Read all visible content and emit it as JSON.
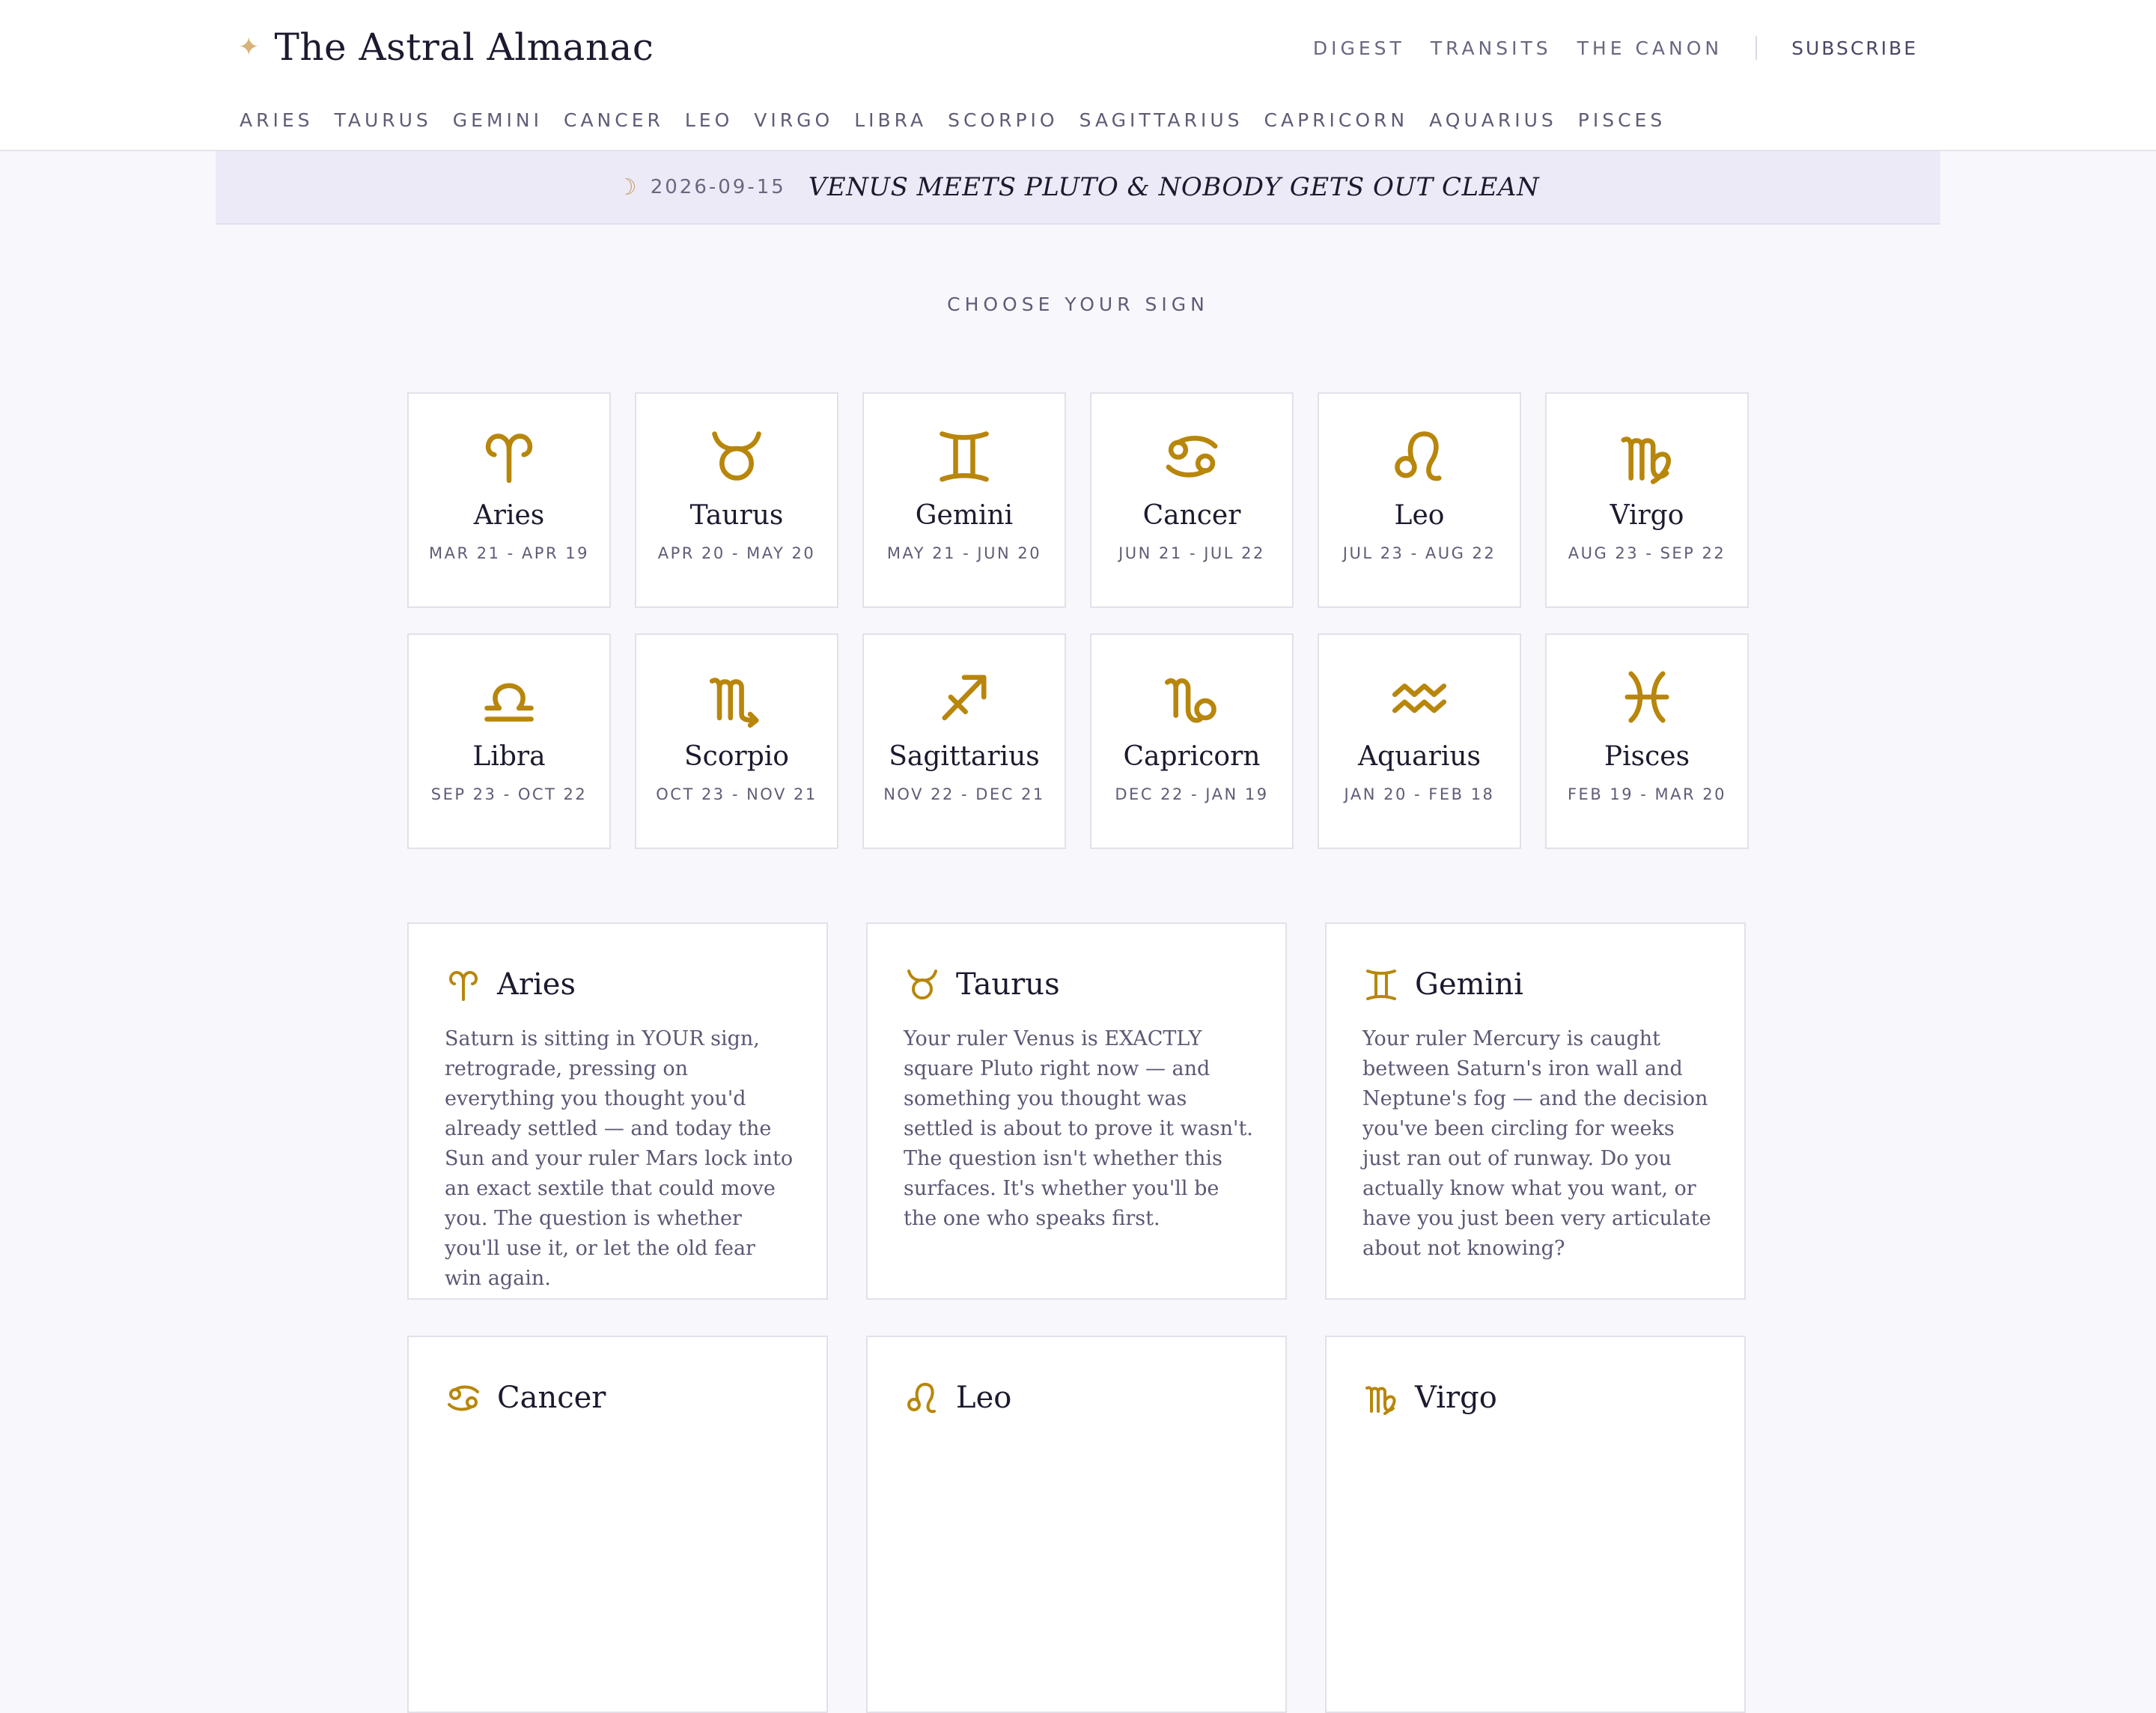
{
  "brand": {
    "title": "The Astral Almanac",
    "icon": "star-icon"
  },
  "topnav": {
    "digest": "DIGEST",
    "transits": "TRANSITS",
    "canon": "THE CANON",
    "subscribe": "SUBSCRIBE"
  },
  "signnav": [
    "ARIES",
    "TAURUS",
    "GEMINI",
    "CANCER",
    "LEO",
    "VIRGO",
    "LIBRA",
    "SCORPIO",
    "SAGITTARIUS",
    "CAPRICORN",
    "AQUARIUS",
    "PISCES"
  ],
  "banner": {
    "icon": "moon-icon",
    "date": "2026-09-15",
    "headline": "VENUS MEETS PLUTO & NOBODY GETS OUT CLEAN"
  },
  "section_label": "CHOOSE YOUR SIGN",
  "signs": [
    {
      "name": "Aries",
      "dates": "MAR 21 - APR 19"
    },
    {
      "name": "Taurus",
      "dates": "APR 20 - MAY 20"
    },
    {
      "name": "Gemini",
      "dates": "MAY 21 - JUN 20"
    },
    {
      "name": "Cancer",
      "dates": "JUN 21 - JUL 22"
    },
    {
      "name": "Leo",
      "dates": "JUL 23 - AUG 22"
    },
    {
      "name": "Virgo",
      "dates": "AUG 23 - SEP 22"
    },
    {
      "name": "Libra",
      "dates": "SEP 23 - OCT 22"
    },
    {
      "name": "Scorpio",
      "dates": "OCT 23 - NOV 21"
    },
    {
      "name": "Sagittarius",
      "dates": "NOV 22 - DEC 21"
    },
    {
      "name": "Capricorn",
      "dates": "DEC 22 - JAN 19"
    },
    {
      "name": "Aquarius",
      "dates": "JAN 20 - FEB 18"
    },
    {
      "name": "Pisces",
      "dates": "FEB 19 - MAR 20"
    }
  ],
  "readings": [
    {
      "name": "Aries",
      "text": "Saturn is sitting in YOUR sign, retrograde, pressing on everything you thought you'd already settled — and today the Sun and your ruler Mars lock into an exact sextile that could move you. The question is whether you'll use it, or let the old fear win again."
    },
    {
      "name": "Taurus",
      "text": "Your ruler Venus is EXACTLY square Pluto right now — and something you thought was settled is about to prove it wasn't. The question isn't whether this surfaces. It's whether you'll be the one who speaks first."
    },
    {
      "name": "Gemini",
      "text": "Your ruler Mercury is caught between Saturn's iron wall and Neptune's fog — and the decision you've been circling for weeks just ran out of runway. Do you actually know what you want, or have you just been very articulate about not knowing?"
    },
    {
      "name": "Cancer",
      "text": ""
    },
    {
      "name": "Leo",
      "text": ""
    },
    {
      "name": "Virgo",
      "text": ""
    }
  ],
  "colors": {
    "accent": "#b8860b",
    "banner_bg": "#edeaf8",
    "page_bg": "#f8f7fc"
  }
}
